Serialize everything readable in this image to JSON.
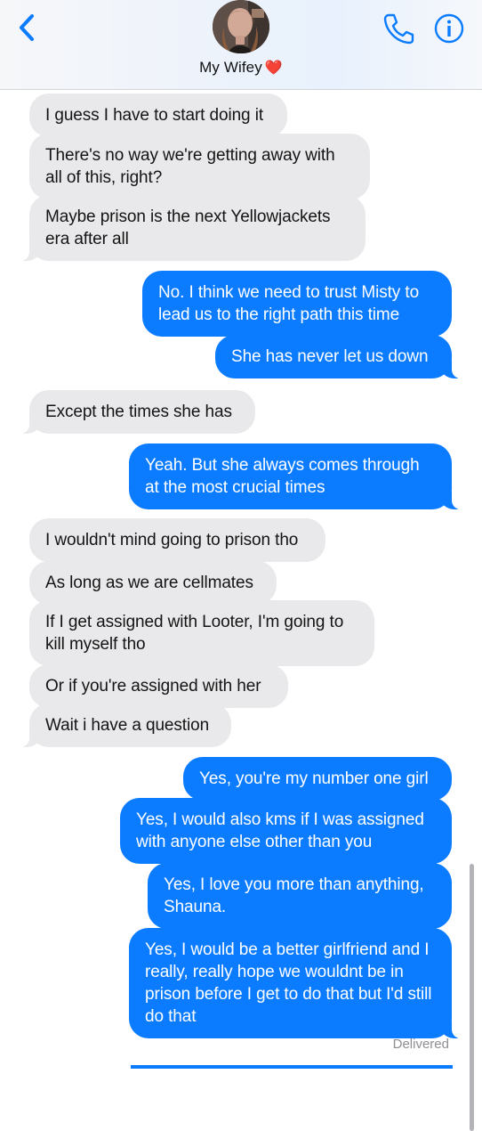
{
  "header": {
    "contact_name": "My Wifey",
    "heart_emoji": "❤️",
    "icons": {
      "back": "chevron-left-icon",
      "call": "phone-icon",
      "info": "info-icon"
    },
    "accent_color": "#0b7cff"
  },
  "messages": [
    {
      "sender": "them",
      "text": "I guess I have to start doing it"
    },
    {
      "sender": "them",
      "text": "There's no way we're getting away with all of this, right?"
    },
    {
      "sender": "them",
      "text": "Maybe prison is the next Yellowjackets era after all"
    },
    {
      "sender": "me",
      "text": "No. I think we need to trust Misty to lead us to the right path this time"
    },
    {
      "sender": "me",
      "text": "She has never let us down"
    },
    {
      "sender": "them",
      "text": "Except the times she has"
    },
    {
      "sender": "me",
      "text": "Yeah. But she always comes through at the most crucial times"
    },
    {
      "sender": "them",
      "text": "I wouldn't mind going to prison tho"
    },
    {
      "sender": "them",
      "text": "As long as we are cellmates"
    },
    {
      "sender": "them",
      "text": "If I get assigned with Looter, I'm going to kill myself tho"
    },
    {
      "sender": "them",
      "text": "Or if you're assigned with her"
    },
    {
      "sender": "them",
      "text": "Wait i have a question"
    },
    {
      "sender": "me",
      "text": "Yes, you're my number one girl"
    },
    {
      "sender": "me",
      "text": "Yes, I would also kms if I was assigned with anyone else other than you"
    },
    {
      "sender": "me",
      "text": "Yes, I love you more than anything, Shauna."
    },
    {
      "sender": "me",
      "text": "Yes, I would be a better girlfriend and I really, really hope we wouldnt be in prison before I get to do that but I'd still do that"
    }
  ],
  "status": "Delivered",
  "colors": {
    "incoming_bubble": "#e9e9eb",
    "outgoing_bubble": "#0b7cff"
  }
}
